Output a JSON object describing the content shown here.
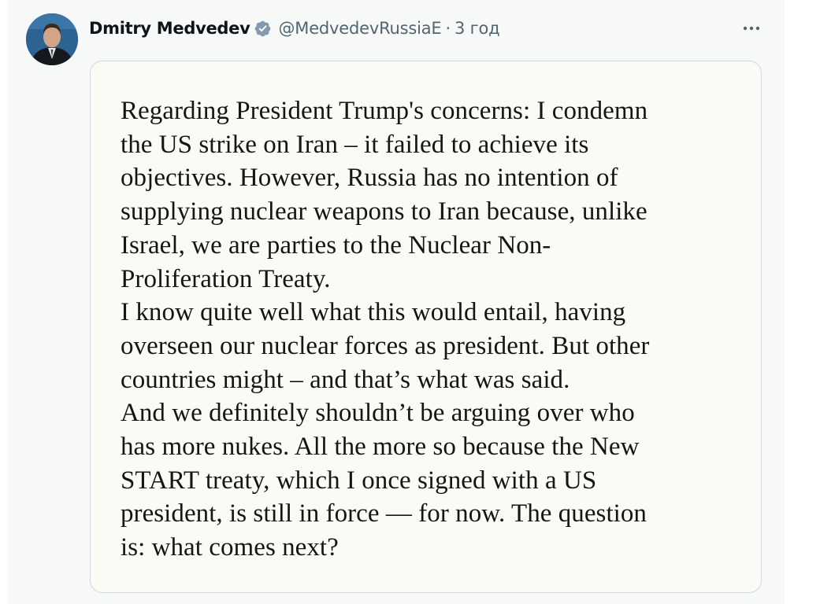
{
  "tweet": {
    "author": {
      "display_name": "Dmitry Medvedev",
      "handle": "@MedvedevRussiaE",
      "separator": "·",
      "timestamp": "3 год",
      "verified": true,
      "verified_badge_color": "#829aab"
    },
    "more_icon": "more-horizontal-icon",
    "media": {
      "lines": [
        "Regarding President Trump's concerns: I condemn",
        "the US strike on Iran – it failed to achieve its",
        "objectives. However, Russia has no intention of",
        "supplying nuclear weapons to Iran because, unlike",
        "Israel, we are parties to the Nuclear Non-",
        "Proliferation Treaty.",
        "I know quite well what this would entail, having",
        "overseen our nuclear forces as president. But other",
        "countries might – and that’s what was said.",
        "And we definitely shouldn’t be arguing over who",
        "has more nukes. All the more so because the New",
        "START treaty, which I once signed with a US",
        "president, is still in force — for now. The question",
        "is: what comes next?"
      ]
    }
  },
  "colors": {
    "feed_background": "#f7f9f9",
    "name_text": "#0f1419",
    "secondary_text": "#536471",
    "card_border": "#cfd9de",
    "card_background": "#fbfaf5"
  }
}
